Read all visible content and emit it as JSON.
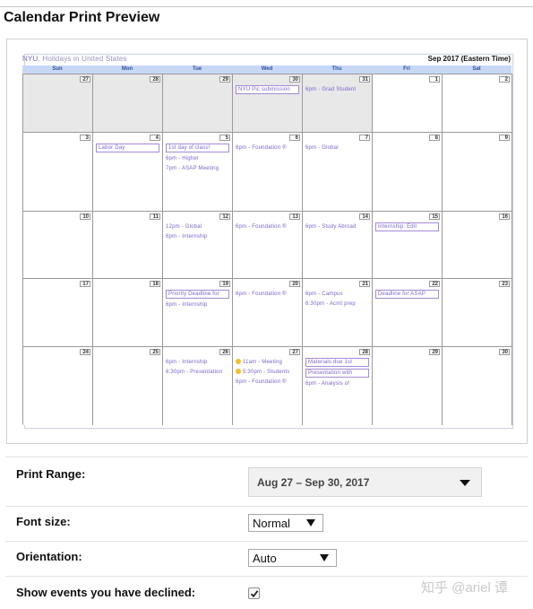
{
  "dialog": {
    "title": "Calendar Print Preview"
  },
  "calendar": {
    "owner_name": "NYU",
    "owner_rest": ", Holidays in United States",
    "range_title": "Sep 2017 (Eastern Time)",
    "weekdays": [
      "Sun",
      "Mon",
      "Tue",
      "Wed",
      "Thu",
      "Fri",
      "Sat"
    ],
    "weeks": [
      {
        "days": [
          {
            "num": "27",
            "past": true,
            "events": []
          },
          {
            "num": "28",
            "past": true,
            "events": []
          },
          {
            "num": "29",
            "past": true,
            "events": []
          },
          {
            "num": "30",
            "past": true,
            "events": [
              {
                "text": "NYU Pic submission",
                "boxed": true
              }
            ]
          },
          {
            "num": "31",
            "past": true,
            "events": [
              {
                "text": "6pm - Grad Student",
                "boxed": false
              }
            ]
          },
          {
            "num": "1",
            "past": false,
            "events": []
          },
          {
            "num": "2",
            "past": false,
            "events": []
          }
        ]
      },
      {
        "days": [
          {
            "num": "3",
            "past": false,
            "events": []
          },
          {
            "num": "4",
            "past": false,
            "events": [
              {
                "text": "Labor Day",
                "boxed": true
              }
            ]
          },
          {
            "num": "5",
            "past": false,
            "events": [
              {
                "text": "1st day of class!",
                "boxed": true
              },
              {
                "text": "6pm - Higher",
                "boxed": false
              },
              {
                "text": "7pm - ASAP Meeting",
                "boxed": false
              }
            ]
          },
          {
            "num": "6",
            "past": false,
            "events": [
              {
                "text": "6pm - Foundation ®",
                "boxed": false
              }
            ]
          },
          {
            "num": "7",
            "past": false,
            "events": [
              {
                "text": "6pm - Global",
                "boxed": false
              }
            ]
          },
          {
            "num": "8",
            "past": false,
            "events": []
          },
          {
            "num": "9",
            "past": false,
            "events": []
          }
        ]
      },
      {
        "days": [
          {
            "num": "10",
            "past": false,
            "events": []
          },
          {
            "num": "11",
            "past": false,
            "events": []
          },
          {
            "num": "12",
            "past": false,
            "events": [
              {
                "text": "12pm - Global",
                "boxed": false
              },
              {
                "text": "6pm - Internship",
                "boxed": false
              }
            ]
          },
          {
            "num": "13",
            "past": false,
            "events": [
              {
                "text": "6pm - Foundation ®",
                "boxed": false
              }
            ]
          },
          {
            "num": "14",
            "past": false,
            "events": [
              {
                "text": "6pm - Study Abroad",
                "boxed": false
              }
            ]
          },
          {
            "num": "15",
            "past": false,
            "events": [
              {
                "text": "Internship: Edit",
                "boxed": true
              }
            ]
          },
          {
            "num": "16",
            "past": false,
            "events": []
          }
        ]
      },
      {
        "days": [
          {
            "num": "17",
            "past": false,
            "events": []
          },
          {
            "num": "18",
            "past": false,
            "events": []
          },
          {
            "num": "19",
            "past": false,
            "events": [
              {
                "text": "Priority Deadline for",
                "boxed": true
              },
              {
                "text": "6pm - Internship",
                "boxed": false
              }
            ]
          },
          {
            "num": "20",
            "past": false,
            "events": [
              {
                "text": "6pm - Foundation ®",
                "boxed": false
              }
            ]
          },
          {
            "num": "21",
            "past": false,
            "events": [
              {
                "text": "6pm - Campus",
                "boxed": false
              },
              {
                "text": "6:30pm - Acmt prep",
                "boxed": false
              }
            ]
          },
          {
            "num": "22",
            "past": false,
            "events": [
              {
                "text": "Deadline for ASAP",
                "boxed": true
              }
            ]
          },
          {
            "num": "23",
            "past": false,
            "events": []
          }
        ]
      },
      {
        "days": [
          {
            "num": "24",
            "past": false,
            "events": []
          },
          {
            "num": "25",
            "past": false,
            "events": []
          },
          {
            "num": "26",
            "past": false,
            "events": [
              {
                "text": "6pm - Internship",
                "boxed": false
              },
              {
                "text": "6:30pm - Presentation",
                "boxed": false
              }
            ]
          },
          {
            "num": "27",
            "past": false,
            "events": [
              {
                "text": "11am - Meeting",
                "boxed": false,
                "dot": true
              },
              {
                "text": "5:30pm - Students",
                "boxed": false,
                "dot": true
              },
              {
                "text": "6pm - Foundation ®",
                "boxed": false
              }
            ]
          },
          {
            "num": "28",
            "past": false,
            "events": [
              {
                "text": "Materials due 1st",
                "boxed": true
              },
              {
                "text": "Presentation with",
                "boxed": true
              },
              {
                "text": "6pm - Analysis of",
                "boxed": false
              }
            ]
          },
          {
            "num": "29",
            "past": false,
            "events": []
          },
          {
            "num": "30",
            "past": false,
            "events": []
          }
        ]
      }
    ]
  },
  "options": {
    "print_range": {
      "label": "Print Range:",
      "value": "Aug 27 – Sep 30, 2017"
    },
    "font_size": {
      "label": "Font size:",
      "value": "Normal"
    },
    "orientation": {
      "label": "Orientation:",
      "value": "Auto"
    },
    "declined": {
      "label": "Show events you have declined:",
      "checked": true
    }
  },
  "watermark": {
    "text": "知乎 @ariel 谭"
  }
}
